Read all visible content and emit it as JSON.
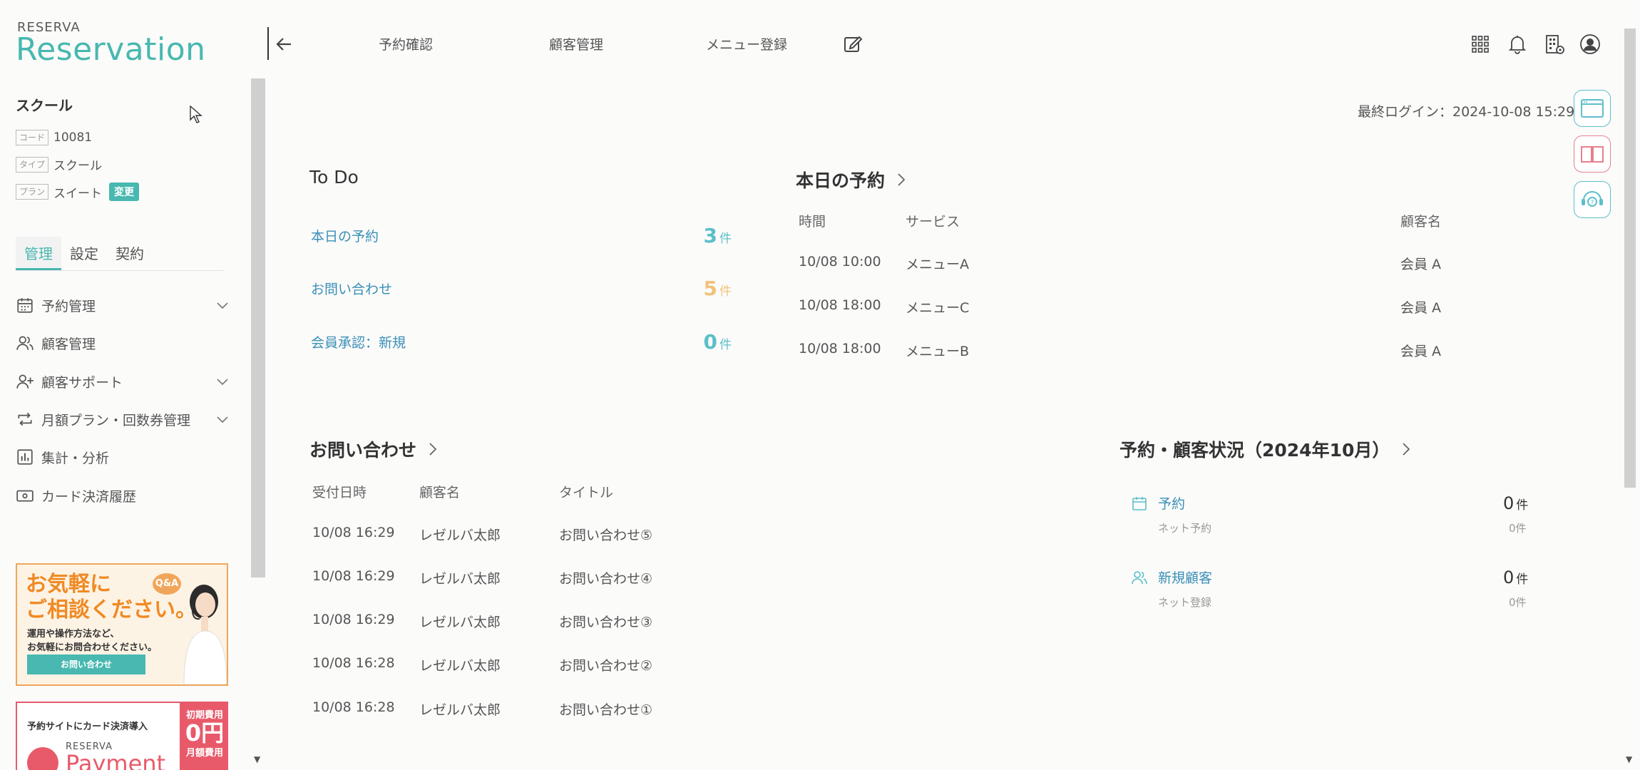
{
  "brand": {
    "small": "RESERVA",
    "large": "Reservation"
  },
  "store": {
    "name": "スクール",
    "code_label": "コード",
    "code_value": "10081",
    "type_label": "タイプ",
    "type_value": "スクール",
    "plan_label": "プラン",
    "plan_value": "スイート",
    "change_label": "変更"
  },
  "side_tabs": [
    "管理",
    "設定",
    "契約"
  ],
  "nav": [
    {
      "label": "予約管理",
      "icon": "calendar-icon",
      "expandable": true
    },
    {
      "label": "顧客管理",
      "icon": "users-icon",
      "expandable": false
    },
    {
      "label": "顧客サポート",
      "icon": "user-plus-icon",
      "expandable": true
    },
    {
      "label": "月額プラン・回数券管理",
      "icon": "repeat-icon",
      "expandable": true
    },
    {
      "label": "集計・分析",
      "icon": "chart-icon",
      "expandable": false
    },
    {
      "label": "カード決済履歴",
      "icon": "card-icon",
      "expandable": false
    }
  ],
  "banner_consult": {
    "title_line1": "お気軽に",
    "title_line2": "ご相談ください。",
    "badge": "Q&A",
    "sub_line1": "運用や操作方法など、",
    "sub_line2": "お気軽にお問合わせください。",
    "button": "お問い合わせ"
  },
  "banner_payment": {
    "title": "予約サイトにカード決済導入",
    "brand": "RESERVA",
    "product": "Payment",
    "fee_label": "初期費用",
    "fee_value": "0円",
    "monthly_label": "月額費用"
  },
  "header": {
    "links": [
      "予約確認",
      "顧客管理",
      "メニュー登録"
    ]
  },
  "last_login": "最終ログイン：2024-10-08 15:29",
  "todo": {
    "title": "To Do",
    "unit": "件",
    "items": [
      {
        "label": "本日の予約",
        "count": "3",
        "color": "#5bbfc9"
      },
      {
        "label": "お問い合わせ",
        "count": "5",
        "color": "#f2c27a"
      },
      {
        "label": "会員承認：新規",
        "count": "0",
        "color": "#5bbfc9"
      }
    ]
  },
  "today": {
    "title": "本日の予約",
    "headers": {
      "time": "時間",
      "service": "サービス",
      "customer": "顧客名"
    },
    "rows": [
      {
        "time": "10/08 10:00",
        "service": "メニューA",
        "customer": "会員 A"
      },
      {
        "time": "10/08 18:00",
        "service": "メニューC",
        "customer": "会員 A"
      },
      {
        "time": "10/08 18:00",
        "service": "メニューB",
        "customer": "会員 A"
      }
    ]
  },
  "inquiries": {
    "title": "お問い合わせ",
    "headers": {
      "date": "受付日時",
      "customer": "顧客名",
      "title": "タイトル"
    },
    "rows": [
      {
        "date": "10/08 16:29",
        "customer": "レゼルバ太郎",
        "title": "お問い合わせ⑤"
      },
      {
        "date": "10/08 16:29",
        "customer": "レゼルバ太郎",
        "title": "お問い合わせ④"
      },
      {
        "date": "10/08 16:29",
        "customer": "レゼルバ太郎",
        "title": "お問い合わせ③"
      },
      {
        "date": "10/08 16:28",
        "customer": "レゼルバ太郎",
        "title": "お問い合わせ②"
      },
      {
        "date": "10/08 16:28",
        "customer": "レゼルバ太郎",
        "title": "お問い合わせ①"
      }
    ]
  },
  "status": {
    "title": "予約・顧客状況（2024年10月）",
    "unit": "件",
    "items": [
      {
        "label": "予約",
        "sub": "ネット予約",
        "value": "0",
        "subvalue": "0件"
      },
      {
        "label": "新規顧客",
        "sub": "ネット登録",
        "value": "0",
        "subvalue": "0件"
      }
    ]
  },
  "colors": {
    "accent": "#48b8b0",
    "link": "#3a8fb7",
    "orange": "#f2c27a",
    "pink": "#e85a6a"
  }
}
